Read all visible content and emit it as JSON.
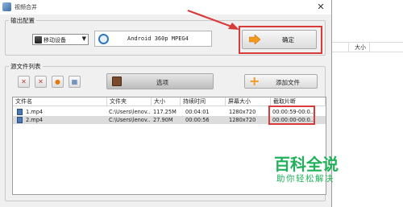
{
  "window": {
    "title": "视频合并",
    "close_glyph": "✕"
  },
  "output_group": {
    "label": "输出配置"
  },
  "device_combo": {
    "value": "移动设备",
    "arrow": "▼"
  },
  "format": {
    "value": "Android 360p MPEG4"
  },
  "ok_button": {
    "label": "确定"
  },
  "source_group": {
    "label": "源文件列表"
  },
  "toolbar": {
    "buttons": [
      {
        "name": "remove-file",
        "glyph": "✕"
      },
      {
        "name": "clear-list",
        "glyph": "✕"
      },
      {
        "name": "play-file",
        "glyph": "●"
      },
      {
        "name": "info-file",
        "glyph": "▦"
      }
    ]
  },
  "options_button": {
    "label": "选项"
  },
  "add_button": {
    "label": "添加文件",
    "glyph": "+"
  },
  "table": {
    "headers": [
      "文件名",
      "文件夹",
      "大小",
      "持续时间",
      "屏幕大小",
      "截取片断"
    ],
    "rows": [
      {
        "name": "1.mp4",
        "folder": "C:\\Users\\lenov...",
        "size": "117.25M",
        "duration": "00:04:01",
        "screen": "1280x720",
        "clip": "00:00:59-00:0...",
        "selected": false
      },
      {
        "name": "2.mp4",
        "folder": "C:\\Users\\lenov...",
        "size": "27.90M",
        "duration": "00:00:56",
        "screen": "1280x720",
        "clip": "00:00:00-00:0...",
        "selected": true
      }
    ]
  },
  "background_window": {
    "column_header": "大小"
  },
  "watermark": {
    "line1": "百科全说",
    "line2": "助你轻松解决"
  },
  "colors": {
    "highlight": "#d93a3a",
    "watermark": "#21b15a",
    "orange": "#f39a1e"
  }
}
